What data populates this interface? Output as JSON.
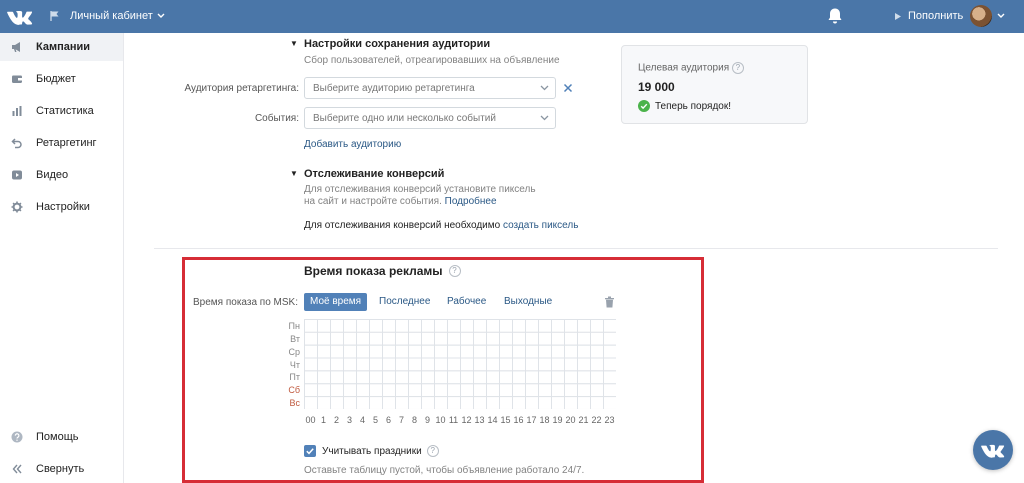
{
  "topbar": {
    "title": "Личный кабинет",
    "topup_label": "Пополнить",
    "accent": "#4a76a8"
  },
  "sidebar": {
    "items": [
      {
        "label": "Кампании",
        "icon": "megaphone-icon",
        "active": true
      },
      {
        "label": "Бюджет",
        "icon": "wallet-icon"
      },
      {
        "label": "Статистика",
        "icon": "bar-chart-icon"
      },
      {
        "label": "Ретаргетинг",
        "icon": "retarget-icon"
      },
      {
        "label": "Видео",
        "icon": "video-icon"
      },
      {
        "label": "Настройки",
        "icon": "gear-icon"
      }
    ],
    "help_label": "Помощь",
    "collapse_label": "Свернуть"
  },
  "audience_save": {
    "title": "Настройки сохранения аудитории",
    "subtitle": "Сбор пользователей, отреагировавших на объявление",
    "retarget_label": "Аудитория ретаргетинга:",
    "retarget_placeholder": "Выберите аудиторию ретаргетинга",
    "events_label": "События:",
    "events_placeholder": "Выберите одно или несколько событий",
    "add_audience_link": "Добавить аудиторию"
  },
  "conversion": {
    "title": "Отслеживание конверсий",
    "desc_line1": "Для отслеживания конверсий установите пиксель",
    "desc_line2": "на сайт и настройте события.",
    "more_link": "Подробнее",
    "need_pixel_text": "Для отслеживания конверсий необходимо",
    "create_pixel_link": "создать пиксель"
  },
  "target_audience": {
    "label": "Целевая аудитория",
    "value": "19 000",
    "status": "Теперь порядок!"
  },
  "schedule": {
    "title": "Время показа рекламы",
    "msk_label": "Время показа по MSK:",
    "tabs": [
      "Моё время",
      "Последнее",
      "Рабочее",
      "Выходные"
    ],
    "active_tab": 0,
    "days": [
      "Пн",
      "Вт",
      "Ср",
      "Чт",
      "Пт",
      "Сб",
      "Вс"
    ],
    "weekend_days": [
      5,
      6
    ],
    "hours": [
      "00",
      "1",
      "2",
      "3",
      "4",
      "5",
      "6",
      "7",
      "8",
      "9",
      "10",
      "11",
      "12",
      "13",
      "14",
      "15",
      "16",
      "17",
      "18",
      "19",
      "20",
      "21",
      "22",
      "23"
    ],
    "holidays_label": "Учитывать праздники",
    "holidays_checked": true,
    "hint": "Оставьте таблицу пустой, чтобы объявление работало 24/7."
  }
}
